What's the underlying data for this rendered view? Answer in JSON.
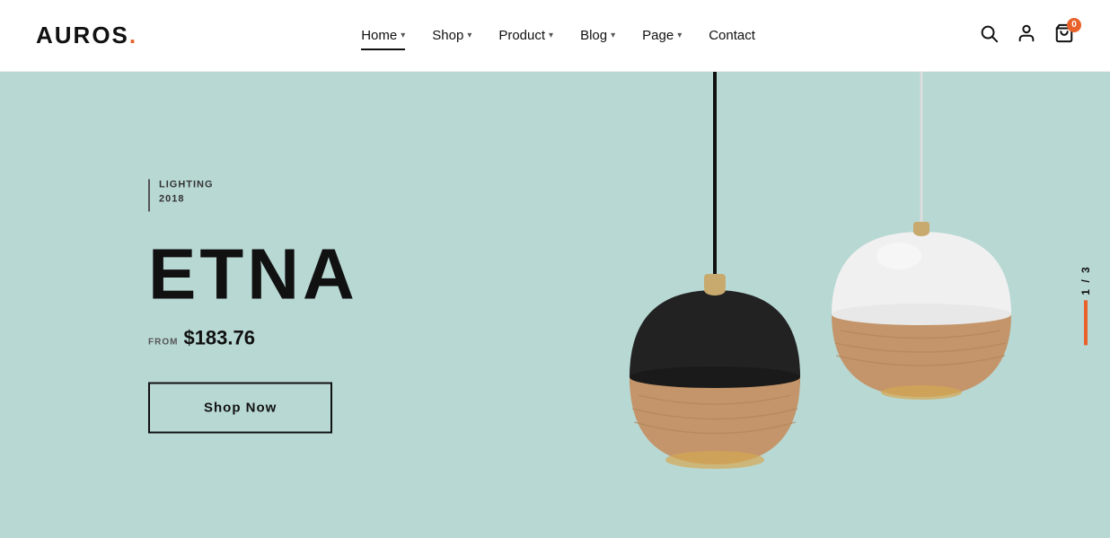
{
  "header": {
    "logo_text": "AUROS",
    "logo_dot": ".",
    "nav_items": [
      {
        "label": "Home",
        "has_dropdown": true,
        "active": true
      },
      {
        "label": "Shop",
        "has_dropdown": true,
        "active": false
      },
      {
        "label": "Product",
        "has_dropdown": true,
        "active": false
      },
      {
        "label": "Blog",
        "has_dropdown": true,
        "active": false
      },
      {
        "label": "Page",
        "has_dropdown": true,
        "active": false
      },
      {
        "label": "Contact",
        "has_dropdown": false,
        "active": false
      }
    ],
    "cart_count": "0"
  },
  "hero": {
    "category_label": "LIGHTING",
    "year": "2018",
    "title": "ETNA",
    "price_from_label": "FROM",
    "price": "$183.76",
    "cta_label": "Shop Now",
    "slide_current": "1",
    "slide_total": "3"
  }
}
